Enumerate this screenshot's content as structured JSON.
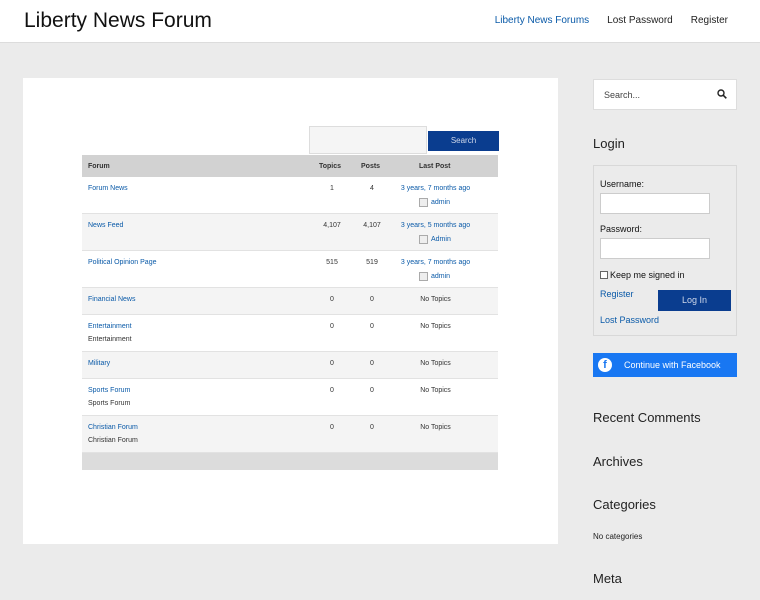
{
  "header": {
    "site_title": "Liberty News Forum",
    "nav": [
      {
        "label": "Liberty News Forums",
        "active": true
      },
      {
        "label": "Lost Password",
        "active": false
      },
      {
        "label": "Register",
        "active": false
      }
    ]
  },
  "forum_search": {
    "button_label": "Search",
    "value": ""
  },
  "forum_table": {
    "columns": [
      "Forum",
      "Topics",
      "Posts",
      "Last Post"
    ],
    "rows": [
      {
        "name": "Forum News",
        "description": "",
        "topics": "1",
        "posts": "4",
        "last_post": "3 years, 7 months ago",
        "author": "admin"
      },
      {
        "name": "News Feed",
        "description": "",
        "topics": "4,107",
        "posts": "4,107",
        "last_post": "3 years, 5 months ago",
        "author": "Admin"
      },
      {
        "name": "Political Opinion Page",
        "description": "",
        "topics": "515",
        "posts": "519",
        "last_post": "3 years, 7 months ago",
        "author": "admin"
      },
      {
        "name": "Financial News",
        "description": "",
        "topics": "0",
        "posts": "0",
        "last_post": "No Topics",
        "author": ""
      },
      {
        "name": "Entertainment",
        "description": "Entertainment",
        "topics": "0",
        "posts": "0",
        "last_post": "No Topics",
        "author": ""
      },
      {
        "name": "Military",
        "description": "",
        "topics": "0",
        "posts": "0",
        "last_post": "No Topics",
        "author": ""
      },
      {
        "name": "Sports Forum",
        "description": "Sports Forum",
        "topics": "0",
        "posts": "0",
        "last_post": "No Topics",
        "author": ""
      },
      {
        "name": "Christian Forum",
        "description": "Christian Forum",
        "topics": "0",
        "posts": "0",
        "last_post": "No Topics",
        "author": ""
      }
    ]
  },
  "sidebar": {
    "search_placeholder": "Search...",
    "login": {
      "heading": "Login",
      "username_label": "Username:",
      "password_label": "Password:",
      "remember_label": "Keep me signed in",
      "register_link": "Register",
      "login_button": "Log In",
      "lost_password_link": "Lost Password"
    },
    "facebook_button": "Continue with Facebook",
    "recent_comments_heading": "Recent Comments",
    "archives_heading": "Archives",
    "categories_heading": "Categories",
    "categories_empty": "No categories",
    "meta_heading": "Meta"
  },
  "colors": {
    "link": "#0a5aa8",
    "button": "#0a3d8f",
    "facebook": "#1877f2",
    "page_bg": "#ebebeb"
  }
}
